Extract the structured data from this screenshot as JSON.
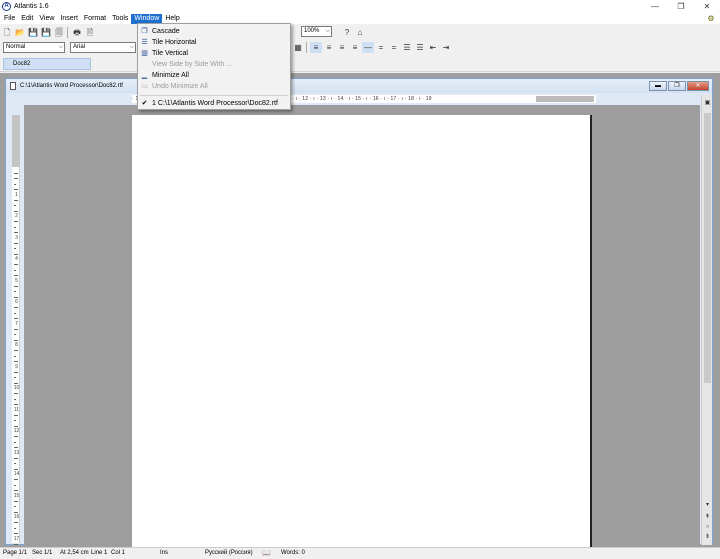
{
  "app": {
    "title": "Atlantis 1.6",
    "icon_letter": "A"
  },
  "window_controls": {
    "minimize": "—",
    "restore": "❐",
    "close": "✕"
  },
  "menu": {
    "items": [
      "File",
      "Edit",
      "View",
      "Insert",
      "Format",
      "Tools",
      "Window",
      "Help"
    ],
    "active": "Window"
  },
  "toolbar": {
    "zoom_value": "100%",
    "style_value": "Normal",
    "font_value": "Arial"
  },
  "doc_tab": {
    "label": "Doc82"
  },
  "document_window": {
    "title": "C:\\1\\Atlantis Word Processor\\Doc82.rtf",
    "controls": [
      "▬",
      "❐",
      "✕"
    ]
  },
  "ruler": {
    "horizontal": "· 1 · ı · 2 · ı · 3 · ı · 4 · ı · 5 · ı · 6 · ı · 7 · ı · 8 · ı · 9 · ı · 10 · ı · 11 · ı · 12 · ı · 13 · ı · 14 · ı · 15 · ı · 16 · ı · 17 · ı · 18 · ı · 19",
    "vertical_numbers": [
      "1",
      "2",
      "3",
      "4",
      "5",
      "6",
      "7",
      "8",
      "9",
      "10",
      "11",
      "12",
      "13",
      "14",
      "15",
      "16",
      "17"
    ]
  },
  "window_menu": {
    "items": [
      {
        "label": "Cascade",
        "icon": "cascade-icon",
        "enabled": true
      },
      {
        "label": "Tile Horizontal",
        "icon": "tile-horizontal-icon",
        "enabled": true
      },
      {
        "label": "Tile Vertical",
        "icon": "tile-vertical-icon",
        "enabled": true
      },
      {
        "label": "View Side by Side With ...",
        "icon": "",
        "enabled": false
      },
      {
        "label": "Minimize All",
        "icon": "minimize-all-icon",
        "enabled": true
      },
      {
        "label": "Undo Minimize All",
        "icon": "undo-minimize-icon",
        "enabled": false
      }
    ],
    "open_doc": {
      "label": "1 C:\\1\\Atlantis Word Processor\\Doc82.rtf",
      "checked": true
    }
  },
  "status": {
    "page": "Page 1/1",
    "section": "Sec 1/1",
    "position": "At 2,54 cm",
    "line": "Line 1",
    "col": "Col 1",
    "mode": "Ins",
    "language": "Русский (Россия)",
    "words": "Words: 0"
  },
  "colors": {
    "accent": "#1f6fd1",
    "mdi_bg": "#9e9e9e",
    "page": "#ffffff"
  }
}
